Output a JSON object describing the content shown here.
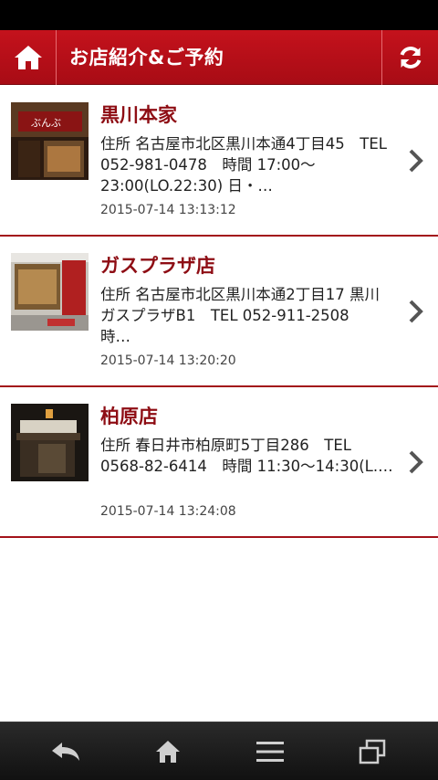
{
  "header": {
    "title": "お店紹介&ご予約",
    "home_icon": "home-icon",
    "refresh_icon": "refresh-icon",
    "accent": "#b3101a"
  },
  "stores": [
    {
      "name": "黒川本家",
      "description": "住所 名古屋市北区黒川本通4丁目45　TEL 052-981-0478　時間 17:00〜23:00(LO.22:30) 日・…",
      "date": "2015-07-14 13:13:12"
    },
    {
      "name": "ガスプラザ店",
      "description": "住所 名古屋市北区黒川本通2丁目17 黒川ガスプラザB1　TEL 052-911-2508　時…",
      "date": "2015-07-14 13:20:20"
    },
    {
      "name": "柏原店",
      "description": "住所 春日井市柏原町5丁目286　TEL 0568-82-6414　時間 11:30〜14:30(L.…",
      "date": "2015-07-14 13:24:08"
    }
  ],
  "navbar": {
    "icons": [
      "back-icon",
      "home-icon",
      "menu-icon",
      "recent-apps-icon"
    ]
  }
}
